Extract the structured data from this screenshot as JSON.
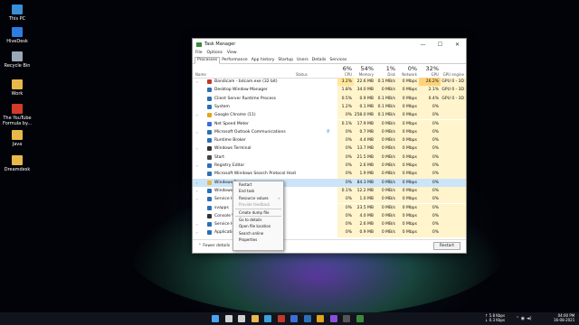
{
  "desktop": {
    "icons": [
      {
        "label": "This PC",
        "icon": "monitor-icon",
        "color": "#3a8fd9"
      },
      {
        "label": "HiveDesk",
        "icon": "hivedesk-icon",
        "color": "#2d7de0"
      },
      {
        "label": "Recycle Bin",
        "icon": "recycle-bin-icon",
        "color": "#9aa7b8"
      },
      {
        "label": "Work",
        "icon": "folder-icon",
        "color": "#e8b94a"
      },
      {
        "label": "The YouTube Formula by...",
        "icon": "pdf-icon",
        "color": "#d43a2a"
      },
      {
        "label": "Java",
        "icon": "folder-icon",
        "color": "#e8b94a"
      },
      {
        "label": "Dreamdesk",
        "icon": "folder-icon",
        "color": "#e8b94a"
      }
    ]
  },
  "window": {
    "title": "Task Manager",
    "controls": {
      "minimize": "—",
      "maximize": "☐",
      "close": "✕"
    },
    "menu": [
      "File",
      "Options",
      "View"
    ],
    "tabs": [
      "Processes",
      "Performance",
      "App history",
      "Startup",
      "Users",
      "Details",
      "Services"
    ],
    "active_tab": "Processes",
    "columns": {
      "name": "Name",
      "status": "Status",
      "cpu": {
        "pct": "6%",
        "label": "CPU"
      },
      "memory": {
        "pct": "54%",
        "label": "Memory"
      },
      "disk": {
        "pct": "1%",
        "label": "Disk"
      },
      "network": {
        "pct": "0%",
        "label": "Network"
      },
      "gpu": {
        "pct": "32%",
        "label": "GPU"
      },
      "gpu_engine": {
        "label": "GPU engine"
      }
    },
    "rows": [
      {
        "name": "Bandicam - bdcam.exe (32 bit)",
        "expand": "›",
        "icon_color": "#c0392b",
        "cpu": "3.2%",
        "memory": "22.6 MB",
        "disk": "0.1 MB/s",
        "network": "0 Mbps",
        "gpu": "26.2%",
        "gpu_engine": "GPU 0 - 3D"
      },
      {
        "name": "Desktop Window Manager",
        "expand": "",
        "icon_color": "#2b6fb5",
        "cpu": "1.8%",
        "memory": "34.0 MB",
        "disk": "0 MB/s",
        "network": "0 Mbps",
        "gpu": "2.1%",
        "gpu_engine": "GPU 0 - 3D"
      },
      {
        "name": "Client Server Runtime Process",
        "expand": "",
        "icon_color": "#2b6fb5",
        "cpu": "0.5%",
        "memory": "0.9 MB",
        "disk": "0.1 MB/s",
        "network": "0 Mbps",
        "gpu": "0.4%",
        "gpu_engine": "GPU 0 - 3D"
      },
      {
        "name": "System",
        "expand": "",
        "icon_color": "#2b6fb5",
        "cpu": "1.2%",
        "memory": "0.1 MB",
        "disk": "0.1 MB/s",
        "network": "0 Mbps",
        "gpu": "0%",
        "gpu_engine": ""
      },
      {
        "name": "Google Chrome (11)",
        "expand": "›",
        "icon_color": "#e0a41d",
        "cpu": "0%",
        "memory": "258.0 MB",
        "disk": "0.1 MB/s",
        "network": "0 Mbps",
        "gpu": "0%",
        "gpu_engine": ""
      },
      {
        "name": "Net Speed Meter",
        "expand": "",
        "icon_color": "#3a6fd8",
        "cpu": "0.1%",
        "memory": "17.9 MB",
        "disk": "0 MB/s",
        "network": "0 Mbps",
        "gpu": "0%",
        "gpu_engine": ""
      },
      {
        "name": "Microsoft Outlook Communications",
        "expand": "›",
        "icon_color": "#2b6fb5",
        "cpu": "0%",
        "memory": "0.7 MB",
        "disk": "0 MB/s",
        "network": "0 Mbps",
        "gpu": "0%",
        "gpu_engine": "",
        "status_pin": true
      },
      {
        "name": "Runtime Broker",
        "expand": "",
        "icon_color": "#2b6fb5",
        "cpu": "0%",
        "memory": "4.4 MB",
        "disk": "0 MB/s",
        "network": "0 Mbps",
        "gpu": "0%",
        "gpu_engine": ""
      },
      {
        "name": "Windows Terminal",
        "expand": "›",
        "icon_color": "#333333",
        "cpu": "0%",
        "memory": "13.7 MB",
        "disk": "0 MB/s",
        "network": "0 Mbps",
        "gpu": "0%",
        "gpu_engine": ""
      },
      {
        "name": "Start",
        "expand": "",
        "icon_color": "#444444",
        "cpu": "0%",
        "memory": "21.5 MB",
        "disk": "0 MB/s",
        "network": "0 Mbps",
        "gpu": "0%",
        "gpu_engine": ""
      },
      {
        "name": "Registry Editor",
        "expand": "›",
        "icon_color": "#2b6fb5",
        "cpu": "0%",
        "memory": "2.6 MB",
        "disk": "0 MB/s",
        "network": "0 Mbps",
        "gpu": "0%",
        "gpu_engine": ""
      },
      {
        "name": "Microsoft Windows Search Protocol Host",
        "expand": "",
        "icon_color": "#2b6fb5",
        "cpu": "0%",
        "memory": "1.9 MB",
        "disk": "0 MB/s",
        "network": "0 Mbps",
        "gpu": "0%",
        "gpu_engine": ""
      },
      {
        "name": "Windows Ex",
        "expand": "›",
        "icon_color": "#e8b94a",
        "cpu": "0%",
        "memory": "84.3 MB",
        "disk": "0 MB/s",
        "network": "0 Mbps",
        "gpu": "0%",
        "gpu_engine": "",
        "selected": true
      },
      {
        "name": "Windows A",
        "expand": "›",
        "icon_color": "#2b6fb5",
        "cpu": "0.1%",
        "memory": "12.2 MB",
        "disk": "0 MB/s",
        "network": "0 Mbps",
        "gpu": "0%",
        "gpu_engine": ""
      },
      {
        "name": "Service Ho",
        "expand": "›",
        "icon_color": "#2b6fb5",
        "cpu": "0%",
        "memory": "1.0 MB",
        "disk": "0 MB/s",
        "network": "0 Mbps",
        "gpu": "0%",
        "gpu_engine": ""
      },
      {
        "name": "svapps",
        "expand": "",
        "icon_color": "#2b6fb5",
        "cpu": "0%",
        "memory": "23.5 MB",
        "disk": "0 MB/s",
        "network": "0 Mbps",
        "gpu": "0%",
        "gpu_engine": ""
      },
      {
        "name": "Console Wi",
        "expand": "",
        "icon_color": "#333333",
        "cpu": "0%",
        "memory": "4.0 MB",
        "disk": "0 MB/s",
        "network": "0 Mbps",
        "gpu": "0%",
        "gpu_engine": ""
      },
      {
        "name": "Service Ho",
        "expand": "›",
        "icon_color": "#2b6fb5",
        "cpu": "0%",
        "memory": "2.6 MB",
        "disk": "0 MB/s",
        "network": "0 Mbps",
        "gpu": "0%",
        "gpu_engine": ""
      },
      {
        "name": "Application",
        "expand": "›",
        "icon_color": "#2b6fb5",
        "cpu": "0%",
        "memory": "0.9 MB",
        "disk": "0 MB/s",
        "network": "0 Mbps",
        "gpu": "0%",
        "gpu_engine": ""
      }
    ],
    "footer": {
      "fewer_details": "Fewer details",
      "restart": "Restart"
    }
  },
  "context_menu": {
    "items": [
      {
        "label": "Restart",
        "disabled": false
      },
      {
        "label": "End task",
        "disabled": false
      },
      {
        "label": "Resource values",
        "disabled": false,
        "submenu": "›"
      },
      {
        "label": "Provide feedback",
        "disabled": true
      },
      {
        "separator": true
      },
      {
        "label": "Create dump file",
        "disabled": false
      },
      {
        "separator": true
      },
      {
        "label": "Go to details",
        "disabled": false
      },
      {
        "label": "Open file location",
        "disabled": false
      },
      {
        "label": "Search online",
        "disabled": false
      },
      {
        "label": "Properties",
        "disabled": false
      }
    ]
  },
  "taskbar": {
    "icons": [
      {
        "name": "start-icon",
        "color": "#4aa3f0"
      },
      {
        "name": "search-icon",
        "color": "#d0d0d0"
      },
      {
        "name": "task-view-icon",
        "color": "#d0d0d0"
      },
      {
        "name": "file-explorer-icon",
        "color": "#e8b94a"
      },
      {
        "name": "edge-icon",
        "color": "#3aa0d8"
      },
      {
        "name": "bandicam-icon",
        "color": "#c0392b"
      },
      {
        "name": "store-icon",
        "color": "#3a6fd8"
      },
      {
        "name": "mail-icon",
        "color": "#2b6fb5"
      },
      {
        "name": "chrome-icon",
        "color": "#e0a41d"
      },
      {
        "name": "app-icon",
        "color": "#8a4fd8"
      },
      {
        "name": "terminal-icon",
        "color": "#555555"
      },
      {
        "name": "task-manager-icon",
        "color": "#3a8a3a"
      }
    ],
    "net_speed": {
      "up": "↑ 5.8 Kbps",
      "down": "↓ 0.3 Kbps"
    },
    "clock": {
      "time": "04:00 PM",
      "date": "16-08-2021"
    }
  }
}
